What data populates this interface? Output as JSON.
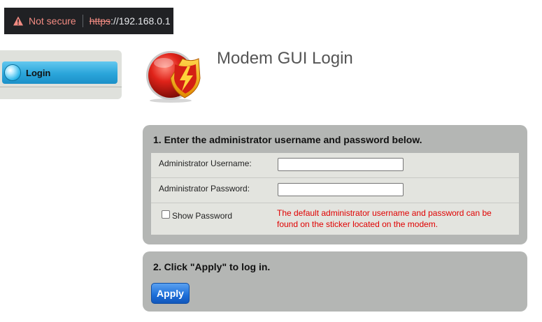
{
  "browser": {
    "security_label": "Not secure",
    "url_scheme": "https",
    "url_separator": "://",
    "url_host": "192.168.0.1",
    "warning_icon": "warning-triangle-icon"
  },
  "sidebar": {
    "items": [
      {
        "label": "Login",
        "icon": "orb-icon",
        "active": true
      }
    ]
  },
  "header": {
    "title": "Modem GUI Login",
    "logo": "shield-lightning-logo"
  },
  "section1": {
    "heading": "1. Enter the administrator username and password below.",
    "username_label": "Administrator Username:",
    "username_value": "",
    "password_label": "Administrator Password:",
    "password_value": "",
    "show_password_label": "Show Password",
    "show_password_checked": false,
    "info_message": "The default administrator username and password can be found on the sticker located on the modem."
  },
  "section2": {
    "heading": "2. Click \"Apply\" to log in.",
    "apply_label": "Apply"
  },
  "colors": {
    "addr_bar_bg": "#202124",
    "not_secure": "#f28b82",
    "nav_active": "#2aa5da",
    "panel_bg": "#b4b6b4",
    "form_bg": "#e3e4df",
    "info_text": "#e00000",
    "apply_button": "#1c6ed8"
  }
}
